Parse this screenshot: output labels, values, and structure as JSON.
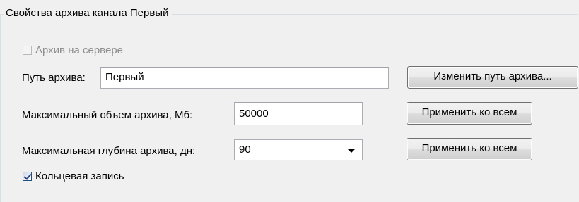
{
  "group": {
    "title": "Свойства архива канала Первый"
  },
  "archive_on_server": {
    "label": "Архив на сервере",
    "checked": false,
    "enabled": false
  },
  "archive_path": {
    "label": "Путь архива:",
    "value": "Первый",
    "change_button": "Изменить путь архива..."
  },
  "max_size": {
    "label": "Максимальный объем архива, Мб:",
    "value": "50000",
    "apply_all_button": "Применить ко всем"
  },
  "max_depth": {
    "label": "Максимальная глубина архива, дн:",
    "value": "90",
    "apply_all_button": "Применить ко всем"
  },
  "ring_record": {
    "label": "Кольцевая запись",
    "checked": true
  }
}
